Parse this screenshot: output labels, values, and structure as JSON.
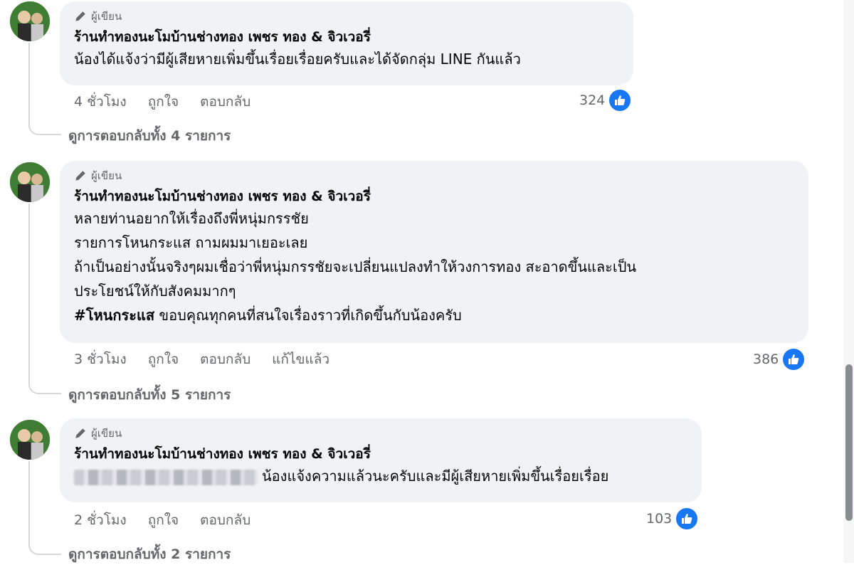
{
  "author_label": "ผู้เขียน",
  "page_name": "ร้านทำทองนะโมบ้านช่างทอง เพชร ทอง & จิวเวอรี่",
  "actions": {
    "like": "ถูกใจ",
    "reply": "ตอบกลับ",
    "edited": "แก้ไขแล้ว"
  },
  "comments": [
    {
      "time": "4 ชั่วโมง",
      "lines": [
        "น้องได้แจ้งว่ามีผู้เสียหายเพิ่มขึ้นเรื่อยเรื่อยครับและได้จัดกลุ่ม LINE กันแล้ว"
      ],
      "reactions": "324",
      "view_replies": "ดูการตอบกลับทั้ง 4 รายการ"
    },
    {
      "time": "3 ชั่วโมง",
      "lines": [
        "หลายท่านอยากให้เรื่องถึงพี่หนุ่มกรรชัย",
        "รายการโหนกระแส ถามผมมาเยอะเลย",
        "ถ้าเป็นอย่างนั้นจริงๆผมเชื่อว่าพี่หนุ่มกรรชัยจะเปลี่ยนแปลงทำให้วงการทอง สะอาดขึ้นและเป็น",
        "ประโยชน์ให้กับสังคมมากๆ"
      ],
      "hashtag": "#โหนกระแส",
      "hashtag_rest": " ขอบคุณทุกคนที่สนใจเรื่องราวที่เกิดขึ้นกับน้องครับ",
      "reactions": "386",
      "view_replies": "ดูการตอบกลับทั้ง 5 รายการ"
    },
    {
      "time": "2 ชั่วโมง",
      "lines": [
        "น้องแจ้งความแล้วนะครับและมีผู้เสียหายเพิ่มขึ้นเรื่อยเรื่อย"
      ],
      "reactions": "103",
      "view_replies": "ดูการตอบกลับทั้ง 2 รายการ"
    }
  ],
  "colors": {
    "bubble": "#f0f2f5",
    "secondary_text": "#65676b",
    "like_blue": "#1877f2"
  },
  "icons": [
    "pencil-icon",
    "like-icon",
    "avatar"
  ]
}
